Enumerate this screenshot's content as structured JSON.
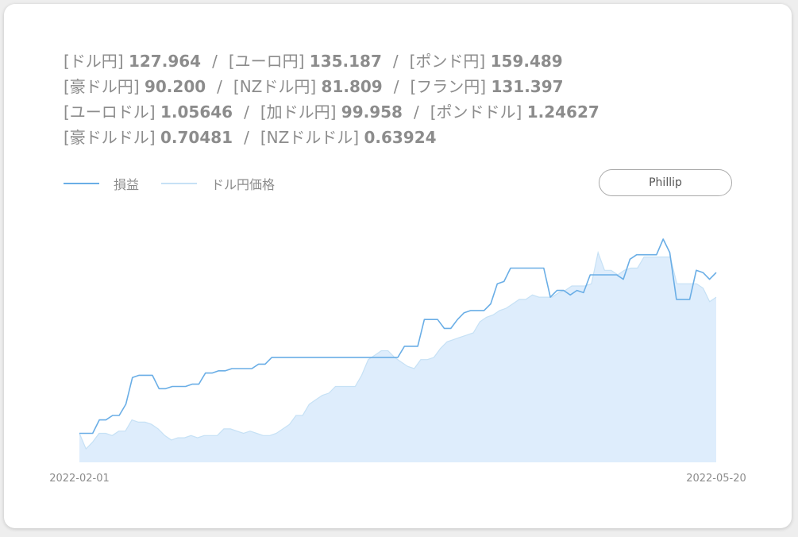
{
  "rates": [
    [
      {
        "label": "[ドル円]",
        "value": "127.964"
      },
      {
        "label": "[ユーロ円]",
        "value": "135.187"
      },
      {
        "label": "[ポンド円]",
        "value": "159.489"
      }
    ],
    [
      {
        "label": "[豪ドル円]",
        "value": "90.200"
      },
      {
        "label": "[NZドル円]",
        "value": "81.809"
      },
      {
        "label": "[フラン円]",
        "value": "131.397"
      }
    ],
    [
      {
        "label": "[ユーロドル]",
        "value": "1.05646"
      },
      {
        "label": "[加ドル円]",
        "value": "99.958"
      },
      {
        "label": "[ポンドドル]",
        "value": "1.24627"
      }
    ],
    [
      {
        "label": "[豪ドルドル]",
        "value": "0.70481"
      },
      {
        "label": "[NZドルドル]",
        "value": "0.63924"
      }
    ]
  ],
  "separator": "/",
  "button_label": "Phillip",
  "colors": {
    "pnl_line": "#6aaee6",
    "price_line": "#c6e1f5",
    "price_fill": "#deedfc"
  },
  "chart_data": {
    "type": "line",
    "legend": [
      "損益",
      "ドル円価格"
    ],
    "x_start": "2022-02-01",
    "x_end": "2022-05-20",
    "x_tick_labels": [
      "2022-02-01",
      "2022-05-20"
    ],
    "y_range": [
      0,
      100
    ],
    "grid": false,
    "series": [
      {
        "name": "損益",
        "style": "line",
        "values": [
          13,
          13,
          13,
          19,
          19,
          21,
          21,
          26,
          38,
          39,
          39,
          39,
          33,
          33,
          34,
          34,
          34,
          35,
          35,
          40,
          40,
          41,
          41,
          42,
          42,
          42,
          42,
          44,
          44,
          47,
          47,
          47,
          47,
          47,
          47,
          47,
          47,
          47,
          47,
          47,
          47,
          47,
          47,
          47,
          47,
          47,
          47,
          47,
          47,
          52,
          52,
          52,
          64,
          64,
          64,
          60,
          60,
          64,
          67,
          68,
          68,
          68,
          71,
          80,
          81,
          87,
          87,
          87,
          87,
          87,
          87,
          74,
          77,
          77,
          75,
          77,
          76,
          84,
          84,
          84,
          84,
          84,
          82,
          91,
          93,
          93,
          93,
          93,
          100,
          94,
          73,
          73,
          73,
          86,
          85,
          82,
          85
        ]
      },
      {
        "name": "ドル円価格",
        "style": "area",
        "values": [
          13,
          6,
          9,
          13,
          13,
          12,
          14,
          14,
          19,
          18,
          18,
          17,
          15,
          12,
          10,
          11,
          11,
          12,
          11,
          12,
          12,
          12,
          15,
          15,
          14,
          13,
          14,
          13,
          12,
          12,
          13,
          15,
          17,
          21,
          21,
          26,
          28,
          30,
          31,
          34,
          34,
          34,
          34,
          39,
          46,
          48,
          50,
          50,
          47,
          45,
          43,
          42,
          46,
          46,
          47,
          51,
          54,
          55,
          56,
          57,
          58,
          63,
          65,
          66,
          68,
          69,
          71,
          73,
          73,
          75,
          74,
          74,
          74,
          76,
          77,
          79,
          79,
          79,
          80,
          94,
          86,
          86,
          84,
          86,
          87,
          87,
          92,
          92,
          92,
          92,
          92,
          80,
          80,
          80,
          80,
          78,
          72,
          74
        ]
      }
    ]
  }
}
